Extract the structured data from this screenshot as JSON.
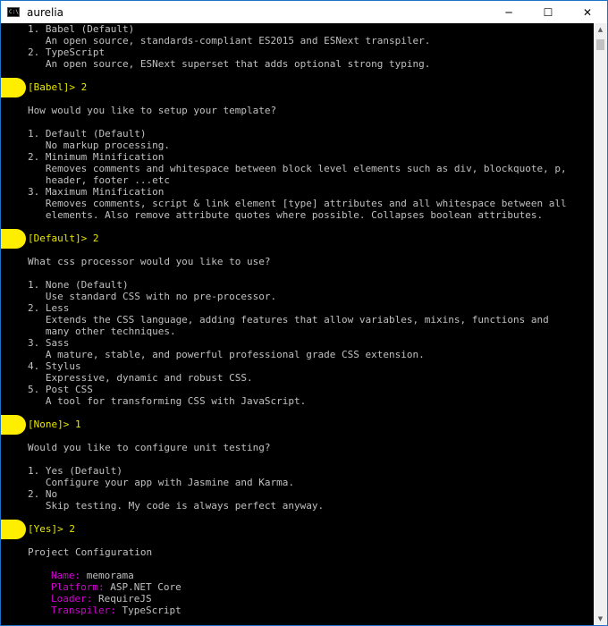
{
  "window": {
    "title": "aurelia",
    "icon_glyph": "C:\\",
    "controls": {
      "minimize": "─",
      "maximize": "☐",
      "close": "✕"
    }
  },
  "console": {
    "lines": [
      "1. Babel (Default)",
      "   An open source, standards-compliant ES2015 and ESNext transpiler.",
      "2. TypeScript",
      "   An open source, ESNext superset that adds optional strong typing.",
      "",
      "[Babel]> 2",
      "",
      "How would you like to setup your template?",
      "",
      "1. Default (Default)",
      "   No markup processing.",
      "2. Minimum Minification",
      "   Removes comments and whitespace between block level elements such as div, blockquote, p,",
      "   header, footer ...etc",
      "3. Maximum Minification",
      "   Removes comments, script & link element [type] attributes and all whitespace between all",
      "   elements. Also remove attribute quotes where possible. Collapses boolean attributes.",
      "",
      "[Default]> 2",
      "",
      "What css processor would you like to use?",
      "",
      "1. None (Default)",
      "   Use standard CSS with no pre-processor.",
      "2. Less",
      "   Extends the CSS language, adding features that allow variables, mixins, functions and",
      "   many other techniques.",
      "3. Sass",
      "   A mature, stable, and powerful professional grade CSS extension.",
      "4. Stylus",
      "   Expressive, dynamic and robust CSS.",
      "5. Post CSS",
      "   A tool for transforming CSS with JavaScript.",
      "",
      "[None]> 1",
      "",
      "Would you like to configure unit testing?",
      "",
      "1. Yes (Default)",
      "   Configure your app with Jasmine and Karma.",
      "2. No",
      "   Skip testing. My code is always perfect anyway.",
      "",
      "[Yes]> 2",
      "",
      "Project Configuration",
      ""
    ],
    "config": [
      {
        "key": "Name:",
        "value": "memorama"
      },
      {
        "key": "Platform:",
        "value": "ASP.NET Core"
      },
      {
        "key": "Loader:",
        "value": "RequireJS"
      },
      {
        "key": "Transpiler:",
        "value": "TypeScript"
      }
    ],
    "colors": {
      "text": "#c0c0c0",
      "prompt": "#e8e800",
      "config_key": "#d400d4",
      "background": "#000000",
      "highlight": "#ffee00"
    }
  },
  "scrollbar": {
    "up_arrow": "▲",
    "down_arrow": "▼"
  }
}
